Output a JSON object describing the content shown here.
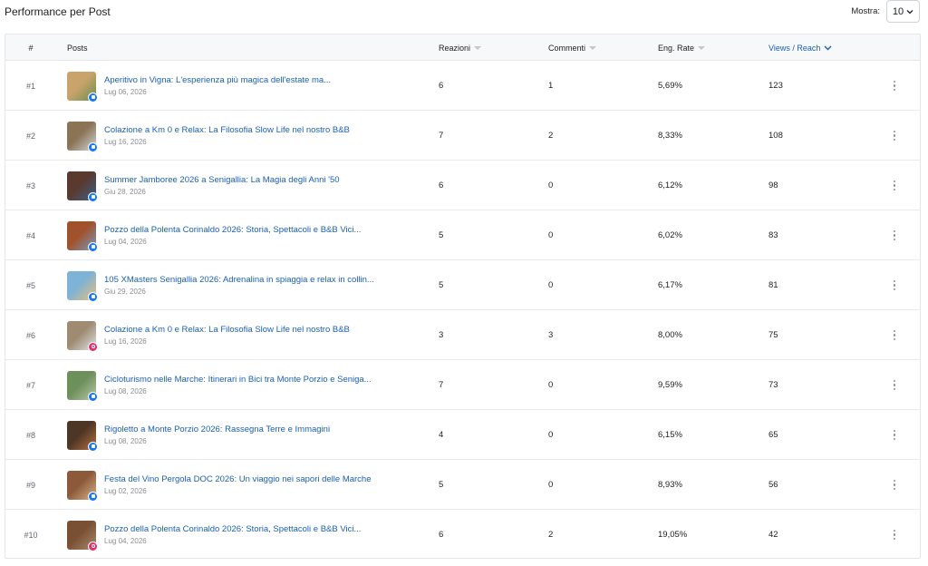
{
  "header": {
    "title": "Performance per Post",
    "show_label": "Mostra:",
    "show_value": "10"
  },
  "columns": {
    "rank": "#",
    "posts": "Posts",
    "reactions": "Reazioni",
    "comments": "Commenti",
    "eng_rate": "Eng. Rate",
    "views": "Views / Reach"
  },
  "colors": {
    "link": "#1a5fb4",
    "facebook": "#1877f2",
    "instagram": "#e1306c"
  },
  "rows": [
    {
      "rank": "#1",
      "title": "Aperitivo in Vigna: L'esperienza più magica dell'estate ma...",
      "date": "Lug 06, 2026",
      "platform": "facebook",
      "reactions": "6",
      "comments": "1",
      "eng_rate": "5,69%",
      "views": "123"
    },
    {
      "rank": "#2",
      "title": "Colazione a Km 0 e Relax: La Filosofia Slow Life nel nostro B&B",
      "date": "Lug 16, 2026",
      "platform": "facebook",
      "reactions": "7",
      "comments": "2",
      "eng_rate": "8,33%",
      "views": "108"
    },
    {
      "rank": "#3",
      "title": "Summer Jamboree 2026 a Senigallia: La Magia degli Anni '50",
      "date": "Giu 28, 2026",
      "platform": "facebook",
      "reactions": "6",
      "comments": "0",
      "eng_rate": "6,12%",
      "views": "98"
    },
    {
      "rank": "#4",
      "title": "Pozzo della Polenta Corinaldo 2026: Storia, Spettacoli e B&B Vici...",
      "date": "Lug 04, 2026",
      "platform": "facebook",
      "reactions": "5",
      "comments": "0",
      "eng_rate": "6,02%",
      "views": "83"
    },
    {
      "rank": "#5",
      "title": "105 XMasters Senigallia 2026: Adrenalina in spiaggia e relax in collin...",
      "date": "Giu 29, 2026",
      "platform": "facebook",
      "reactions": "5",
      "comments": "0",
      "eng_rate": "6,17%",
      "views": "81"
    },
    {
      "rank": "#6",
      "title": "Colazione a Km 0 e Relax: La Filosofia Slow Life nel nostro B&B",
      "date": "Lug 16, 2026",
      "platform": "instagram",
      "reactions": "3",
      "comments": "3",
      "eng_rate": "8,00%",
      "views": "75"
    },
    {
      "rank": "#7",
      "title": "Cicloturismo nelle Marche: Itinerari in Bici tra Monte Porzio e Seniga...",
      "date": "Lug 08, 2026",
      "platform": "facebook",
      "reactions": "7",
      "comments": "0",
      "eng_rate": "9,59%",
      "views": "73"
    },
    {
      "rank": "#8",
      "title": "Rigoletto a Monte Porzio 2026: Rassegna Terre e Immagini",
      "date": "Lug 08, 2026",
      "platform": "facebook",
      "reactions": "4",
      "comments": "0",
      "eng_rate": "6,15%",
      "views": "65"
    },
    {
      "rank": "#9",
      "title": "Festa del Vino Pergola DOC 2026: Un viaggio nei sapori delle Marche",
      "date": "Lug 02, 2026",
      "platform": "facebook",
      "reactions": "5",
      "comments": "0",
      "eng_rate": "8,93%",
      "views": "56"
    },
    {
      "rank": "#10",
      "title": "Pozzo della Polenta Corinaldo 2026: Storia, Spettacoli e B&B Vici...",
      "date": "Lug 04, 2026",
      "platform": "instagram",
      "reactions": "6",
      "comments": "2",
      "eng_rate": "19,05%",
      "views": "42"
    }
  ]
}
